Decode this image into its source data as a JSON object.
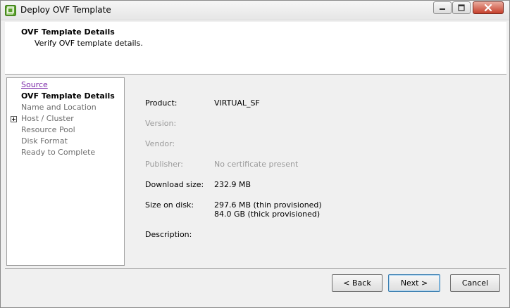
{
  "window": {
    "title": "Deploy OVF Template",
    "icon": "vsphere-app-icon"
  },
  "header": {
    "title": "OVF Template Details",
    "subtitle": "Verify OVF template details."
  },
  "nav": {
    "items": [
      {
        "label": "Source",
        "state": "visited-link"
      },
      {
        "label": "OVF Template Details",
        "state": "current"
      },
      {
        "label": "Name and Location",
        "state": "disabled"
      },
      {
        "label": "Host / Cluster",
        "state": "disabled",
        "expandable": true
      },
      {
        "label": "Resource Pool",
        "state": "disabled"
      },
      {
        "label": "Disk Format",
        "state": "disabled"
      },
      {
        "label": "Ready to Complete",
        "state": "disabled"
      }
    ]
  },
  "details": {
    "product_label": "Product:",
    "product_value": "VIRTUAL_SF",
    "version_label": "Version:",
    "vendor_label": "Vendor:",
    "publisher_label": "Publisher:",
    "publisher_value": "No certificate present",
    "download_label": "Download size:",
    "download_value": "232.9 MB",
    "size_label": "Size on disk:",
    "size_thin": "297.6 MB (thin provisioned)",
    "size_thick": "84.0 GB (thick provisioned)",
    "description_label": "Description:"
  },
  "buttons": {
    "back": "< Back",
    "next": "Next >",
    "cancel": "Cancel"
  },
  "colors": {
    "link_visited": "#7a27a8",
    "disabled_text": "#6d6d6d",
    "muted_text": "#9a9a9a",
    "close_button": "#c6402c"
  }
}
